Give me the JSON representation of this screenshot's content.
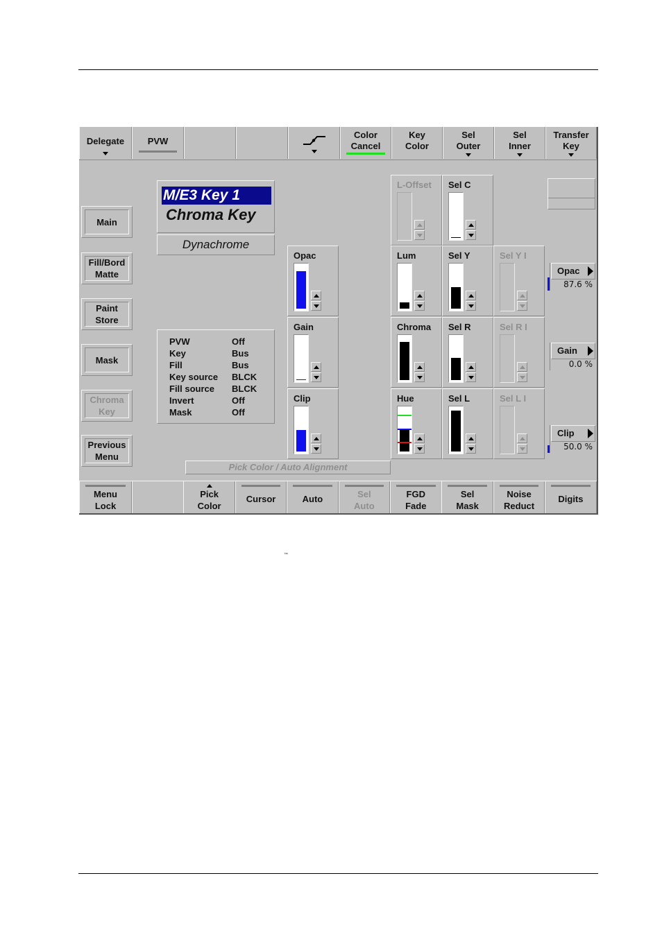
{
  "trademark": "™",
  "top_menu": [
    {
      "label1": "Delegate",
      "label2": "",
      "has_dropdown": true,
      "indicator": ""
    },
    {
      "label1": "PVW",
      "label2": "",
      "has_dropdown": false,
      "indicator": "gray"
    },
    {
      "label1": "",
      "label2": "",
      "has_dropdown": false,
      "indicator": ""
    },
    {
      "label1": "",
      "label2": "",
      "has_dropdown": false,
      "indicator": ""
    },
    {
      "label1": "",
      "label2": "",
      "has_dropdown": true,
      "icon": "transition-curve-icon",
      "indicator": ""
    },
    {
      "label1": "Color",
      "label2": "Cancel",
      "has_dropdown": false,
      "indicator": "green"
    },
    {
      "label1": "Key",
      "label2": "Color",
      "has_dropdown": false,
      "indicator": ""
    },
    {
      "label1": "Sel",
      "label2": "Outer",
      "has_dropdown": true,
      "indicator": ""
    },
    {
      "label1": "Sel",
      "label2": "Inner",
      "has_dropdown": true,
      "indicator": ""
    },
    {
      "label1": "Transfer",
      "label2": "Key",
      "has_dropdown": true,
      "indicator": ""
    }
  ],
  "side_menu": [
    {
      "label1": "Main",
      "label2": "",
      "enabled": true
    },
    {
      "label1": "Fill/Bord",
      "label2": "Matte",
      "enabled": true
    },
    {
      "label1": "Paint",
      "label2": "Store",
      "enabled": true
    },
    {
      "label1": "Mask",
      "label2": "",
      "enabled": true
    },
    {
      "label1": "Chroma",
      "label2": "Key",
      "enabled": false
    },
    {
      "label1": "Previous",
      "label2": "Menu",
      "enabled": true
    }
  ],
  "header": {
    "keyer": "M/E3 Key 1",
    "key_type": "Chroma Key",
    "mode": "Dynachrome"
  },
  "status": [
    {
      "key": "PVW",
      "value": "Off"
    },
    {
      "key": "Key",
      "value": "Bus"
    },
    {
      "key": "Fill",
      "value": "Bus"
    },
    {
      "key": "Key source",
      "value": "BLCK"
    },
    {
      "key": "Fill source",
      "value": "BLCK"
    },
    {
      "key": "Invert",
      "value": "Off"
    },
    {
      "key": "Mask",
      "value": "Off"
    }
  ],
  "pick_color_label": "Pick Color / Auto Alignment",
  "colors": {
    "panel_bg": "#c0c0c0",
    "title_highlight": "#0a0a8c",
    "blue_fill": "#1010ee",
    "black_fill": "#000000",
    "green_indicator": "#22dd22",
    "disabled_text": "#8f8f8f"
  },
  "sliders": {
    "opac": {
      "label": "Opac",
      "level": 0.876,
      "color": "blue",
      "enabled": true
    },
    "gain": {
      "label": "Gain",
      "level": 0.0,
      "color": "blue",
      "enabled": true
    },
    "clip": {
      "label": "Clip",
      "level": 0.5,
      "color": "blue",
      "enabled": true
    },
    "l_offset": {
      "label": "L-Offset",
      "level": 0.0,
      "color": "black",
      "enabled": false
    },
    "sel_c": {
      "label": "Sel C",
      "level": 0.02,
      "color": "black",
      "enabled": true
    },
    "lum": {
      "label": "Lum",
      "level": 0.15,
      "color": "black",
      "enabled": true
    },
    "sel_y": {
      "label": "Sel Y",
      "level": 0.5,
      "color": "black",
      "enabled": true
    },
    "sel_y_i": {
      "label": "Sel Y I",
      "level": 0.0,
      "color": "black",
      "enabled": false
    },
    "chroma": {
      "label": "Chroma",
      "level": 0.88,
      "color": "black",
      "enabled": true
    },
    "sel_r": {
      "label": "Sel R",
      "level": 0.52,
      "color": "black",
      "enabled": true
    },
    "sel_r_i": {
      "label": "Sel R I",
      "level": 0.0,
      "color": "black",
      "enabled": false
    },
    "hue": {
      "label": "Hue",
      "level": 0.5,
      "color": "black",
      "enabled": true,
      "markers": [
        {
          "color": "#22dd22",
          "pos": 0.83
        },
        {
          "color": "#1010ee",
          "pos": 0.5
        },
        {
          "color": "#dd1010",
          "pos": 0.2
        }
      ]
    },
    "sel_l": {
      "label": "Sel L",
      "level": 0.95,
      "color": "black",
      "enabled": true
    },
    "sel_l_i": {
      "label": "Sel L I",
      "level": 0.0,
      "color": "black",
      "enabled": false
    }
  },
  "knobs": [
    {
      "label": "Opac",
      "value": "87.6 %",
      "level": 0.876
    },
    {
      "label": "Gain",
      "value": "0.0 %",
      "level": 0.0
    },
    {
      "label": "Clip",
      "value": "50.0 %",
      "level": 0.5
    }
  ],
  "bottom_menu": [
    {
      "label1": "Menu",
      "label2": "Lock",
      "enabled": true,
      "indicator": true
    },
    {
      "label1": "",
      "label2": "",
      "enabled": true,
      "indicator": false
    },
    {
      "label1": "Pick",
      "label2": "Color",
      "enabled": true,
      "indicator": false,
      "up_arrow": true
    },
    {
      "label1": "Cursor",
      "label2": "",
      "enabled": true,
      "indicator": true
    },
    {
      "label1": "Auto",
      "label2": "",
      "enabled": true,
      "indicator": true
    },
    {
      "label1": "Sel",
      "label2": "Auto",
      "enabled": false,
      "indicator": true
    },
    {
      "label1": "FGD",
      "label2": "Fade",
      "enabled": true,
      "indicator": true
    },
    {
      "label1": "Sel",
      "label2": "Mask",
      "enabled": true,
      "indicator": true
    },
    {
      "label1": "Noise",
      "label2": "Reduct",
      "enabled": true,
      "indicator": true
    },
    {
      "label1": "Digits",
      "label2": "",
      "enabled": true,
      "indicator": true
    }
  ]
}
